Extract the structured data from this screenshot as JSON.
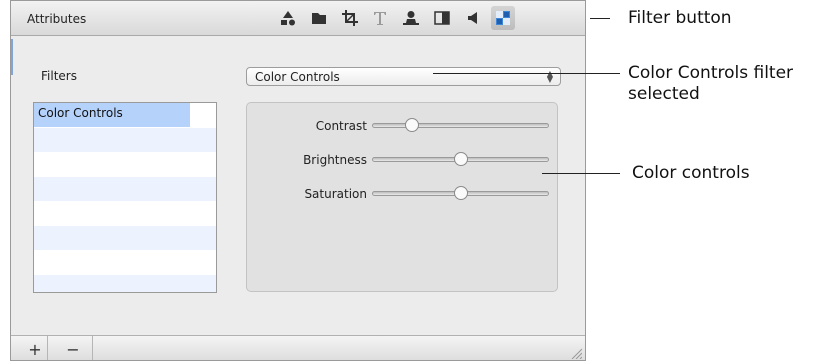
{
  "panel": {
    "title": "Attributes",
    "toolbar": [
      "info-icon",
      "folder-icon",
      "crop-icon",
      "text-icon",
      "person-icon",
      "inspector-icon",
      "speaker-icon",
      "filter-icon"
    ],
    "filters_label": "Filters",
    "filter_select": {
      "value": "Color Controls"
    },
    "filter_list": {
      "items": [
        "Color Controls"
      ],
      "selected": "Color Controls"
    },
    "controls": [
      {
        "label": "Contrast",
        "value": 0.22
      },
      {
        "label": "Brightness",
        "value": 0.5
      },
      {
        "label": "Saturation",
        "value": 0.5
      }
    ],
    "bottom": {
      "add": "+",
      "remove": "−"
    }
  },
  "callouts": {
    "filter_button": "Filter button",
    "filter_selected_1": "Color Controls filter",
    "filter_selected_2": "selected",
    "color_controls": "Color controls"
  },
  "colors": {
    "accent": "#3d86d8",
    "selection": "#b5d2fa"
  }
}
